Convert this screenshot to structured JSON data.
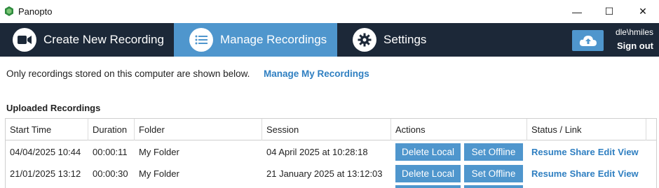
{
  "window": {
    "title": "Panopto",
    "minimize_glyph": "—",
    "maximize_glyph": "☐",
    "close_glyph": "✕"
  },
  "nav": {
    "tabs": [
      {
        "label": "Create New Recording",
        "icon": "video-camera-icon"
      },
      {
        "label": "Manage Recordings",
        "icon": "list-icon",
        "active": true
      },
      {
        "label": "Settings",
        "icon": "gear-icon"
      }
    ],
    "cloud_icon": "cloud-upload-icon",
    "user": "dle\\hmiles",
    "sign_out": "Sign out"
  },
  "content": {
    "notice": "Only recordings stored on this computer are shown below.",
    "manage_link": "Manage My Recordings",
    "section_title": "Uploaded Recordings"
  },
  "table": {
    "columns": [
      "Start Time",
      "Duration",
      "Folder",
      "Session",
      "Actions",
      "Status / Link"
    ],
    "rows": [
      {
        "start_time": "04/04/2025 10:44",
        "duration": "00:00:11",
        "folder": "My Folder",
        "session": "04 April 2025 at 10:28:18",
        "delete": "Delete Local",
        "offline": "Set Offline",
        "links": [
          "Resume",
          "Share",
          "Edit",
          "View"
        ]
      },
      {
        "start_time": "21/01/2025 13:12",
        "duration": "00:00:30",
        "folder": "My Folder",
        "session": "21 January 2025 at 13:12:03",
        "delete": "Delete Local",
        "offline": "Set Offline",
        "links": [
          "Resume",
          "Share",
          "Edit",
          "View"
        ]
      }
    ]
  },
  "colors": {
    "nav_bg": "#1c2838",
    "accent": "#4f96cd",
    "link": "#2f7fc1"
  }
}
